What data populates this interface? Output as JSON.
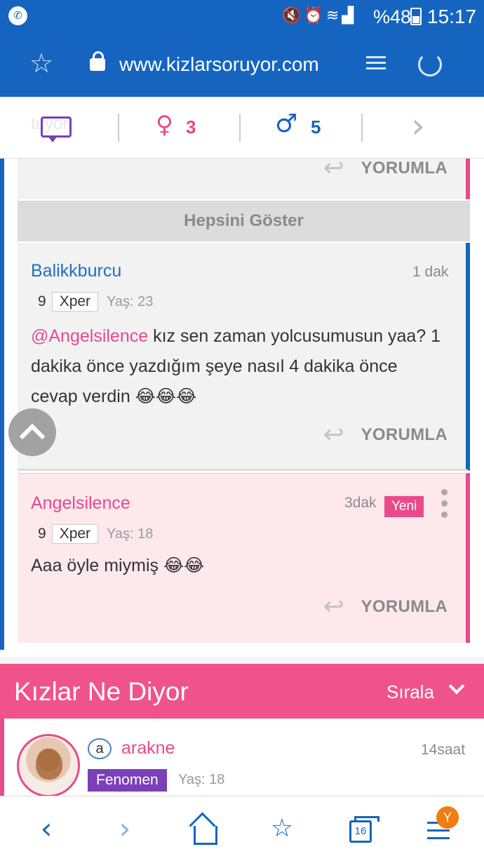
{
  "status_bar": {
    "battery": "%48",
    "time": "15:17"
  },
  "browser": {
    "url": "www.kizlarsoruyor.com"
  },
  "stats_bar": {
    "ghost_text": "tuyor.",
    "female_count": "3",
    "male_count": "5"
  },
  "thread": {
    "reply_label": "YORUMLA",
    "show_all_label": "Hepsini Göster",
    "comments": [
      {
        "author": "Balikkburcu",
        "time": "1 dak",
        "level": "9",
        "xper": "Xper",
        "age": "Yaş: 23",
        "mention": "@Angelsilence",
        "text": " kız sen zaman yolcusumusun yaa? 1 dakika önce yazdığım şeye nasıl 4 dakika önce cevap verdin 😂😂😂"
      },
      {
        "author": "Angelsilence",
        "time": "3dak",
        "new_label": "Yeni",
        "level": "9",
        "xper": "Xper",
        "age": "Yaş: 18",
        "text": "Aaa öyle miymiş 😂😂"
      }
    ]
  },
  "section": {
    "title": "Kızlar Ne Diyor",
    "sort_label": "Sırala"
  },
  "answer": {
    "brand_letter": "a",
    "username": "arakne",
    "time": "14saat",
    "badge": "Fenomen",
    "age": "Yaş: 18"
  },
  "bottom_nav": {
    "tabs_count": "16",
    "profile_initial": "Y"
  },
  "colors": {
    "brand_blue": "#1565c0",
    "brand_pink": "#e84a8a",
    "section_pink": "#f0538a",
    "badge_purple": "#7b3fb8",
    "notification_orange": "#f07d12"
  }
}
